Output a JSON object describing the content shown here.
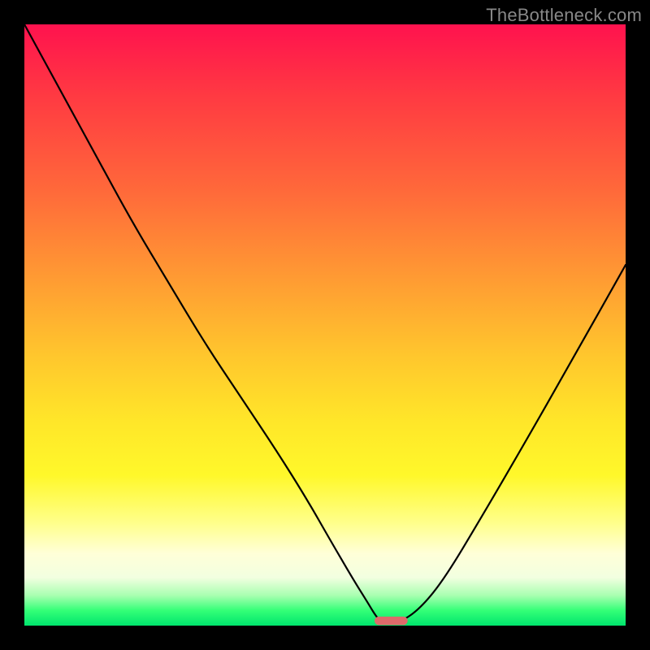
{
  "watermark": "TheBottleneck.com",
  "chart_data": {
    "type": "line",
    "title": "",
    "xlabel": "",
    "ylabel": "",
    "xlim": [
      0,
      100
    ],
    "ylim": [
      0,
      100
    ],
    "grid": false,
    "series": [
      {
        "name": "bottleneck-curve",
        "x": [
          0,
          6,
          12,
          18,
          24,
          30,
          36,
          42,
          47,
          51,
          54.5,
          57,
          58.5,
          59.5,
          62.5,
          66,
          70,
          76,
          83,
          91,
          100
        ],
        "y": [
          100,
          89,
          78,
          67,
          57,
          47,
          38,
          29,
          21,
          14,
          8,
          4,
          1.5,
          0.5,
          0.5,
          3,
          8,
          18,
          30,
          44,
          60
        ]
      }
    ],
    "marker": {
      "name": "optimal-point",
      "x": 61,
      "y": 0.8,
      "width_pct": 5.5,
      "height_pct": 1.4,
      "color": "#dd6a6a"
    },
    "background_gradient_stops": [
      {
        "pct": 0,
        "color": "#ff124e"
      },
      {
        "pct": 28,
        "color": "#ff6a3a"
      },
      {
        "pct": 55,
        "color": "#ffc62d"
      },
      {
        "pct": 75,
        "color": "#fff82a"
      },
      {
        "pct": 90,
        "color": "#ffffd8"
      },
      {
        "pct": 100,
        "color": "#00e56d"
      }
    ]
  }
}
